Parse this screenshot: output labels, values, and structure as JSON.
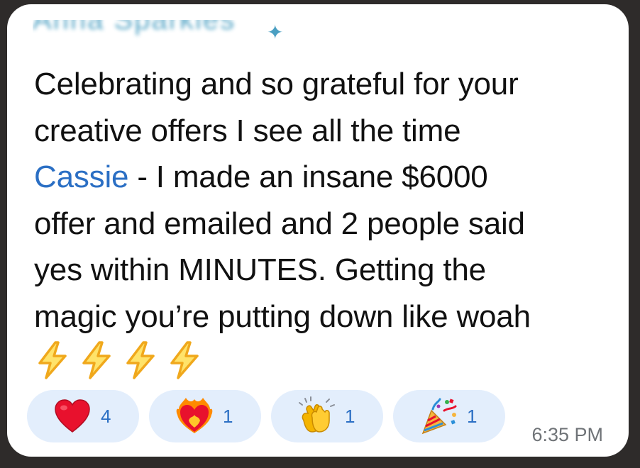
{
  "sender": {
    "name": "Anna Sparkles",
    "sparkle": "✦"
  },
  "message": {
    "line1": "Celebrating and so grateful for your",
    "line2": "creative offers I see all the time",
    "mention": "Cassie",
    "line3_rest": " - I made an insane $6000",
    "line4": "offer and emailed and 2 people said",
    "line5": "yes within MINUTES. Getting the",
    "line6": "magic you’re putting down like woah"
  },
  "emoji_row": [
    "high-voltage-icon",
    "high-voltage-icon",
    "high-voltage-icon",
    "high-voltage-icon"
  ],
  "reactions": [
    {
      "icon": "heart-icon",
      "count": "4"
    },
    {
      "icon": "heart-on-fire-icon",
      "count": "1"
    },
    {
      "icon": "clapping-hands-icon",
      "count": "1"
    },
    {
      "icon": "party-popper-icon",
      "count": "1"
    }
  ],
  "timestamp": "6:35 PM",
  "colors": {
    "mention": "#2b6fc4",
    "reaction_bg": "#e3eefc",
    "reaction_count": "#2b6fc4",
    "timestamp": "#6f7377",
    "bubble": "#ffffff",
    "background": "#2e2b2a"
  }
}
